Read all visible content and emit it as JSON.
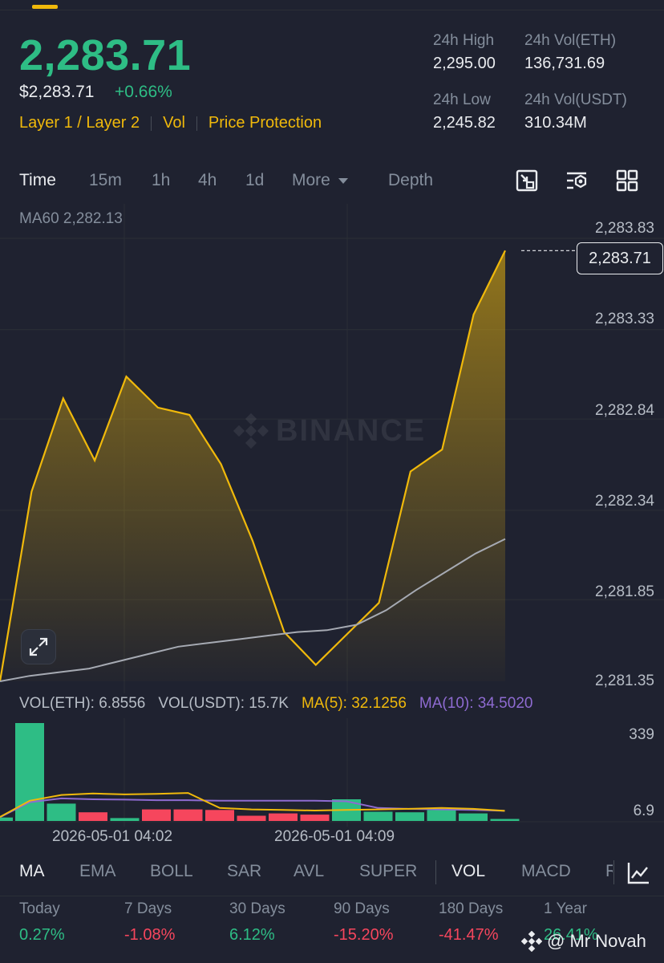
{
  "header": {
    "last_price": "2,283.71",
    "usd_price": "$2,283.71",
    "change_pct": "+0.66%",
    "tags": [
      "Layer 1 / Layer 2",
      "Vol",
      "Price Protection"
    ],
    "stats": {
      "high_label": "24h High",
      "high_value": "2,295.00",
      "vol_eth_label": "24h Vol(ETH)",
      "vol_eth_value": "136,731.69",
      "low_label": "24h Low",
      "low_value": "2,245.82",
      "vol_usdt_label": "24h Vol(USDT)",
      "vol_usdt_value": "310.34M"
    }
  },
  "tabs": {
    "time": "Time",
    "m15": "15m",
    "h1": "1h",
    "h4": "4h",
    "d1": "1d",
    "more": "More",
    "depth": "Depth"
  },
  "chart": {
    "ma60_label": "MA60 2,282.13",
    "current_price_tag": "2,283.71",
    "watermark": "BINANCE",
    "y_labels": [
      "2,283.83",
      "2,283.33",
      "2,282.84",
      "2,282.34",
      "2,281.85",
      "2,281.35"
    ]
  },
  "volume": {
    "vol_eth": "VOL(ETH): 6.8556",
    "vol_usdt": "VOL(USDT): 15.7K",
    "ma5": "MA(5): 32.1256",
    "ma10": "MA(10): 34.5020",
    "y_top": "339",
    "y_bottom": "6.9",
    "x_labels": [
      "2026-05-01 04:02",
      "2026-05-01 04:09"
    ]
  },
  "indicators": {
    "left": [
      "MA",
      "EMA",
      "BOLL",
      "SAR",
      "AVL",
      "SUPER"
    ],
    "right": [
      "VOL",
      "MACD",
      "R"
    ]
  },
  "performance": [
    {
      "label": "Today",
      "value": "0.27%"
    },
    {
      "label": "7 Days",
      "value": "-1.08%"
    },
    {
      "label": "30 Days",
      "value": "6.12%"
    },
    {
      "label": "90 Days",
      "value": "-15.20%"
    },
    {
      "label": "180 Days",
      "value": "-41.47%"
    },
    {
      "label": "1 Year",
      "value": "26.41%"
    }
  ],
  "footer_watermark": "@ Mr Novah",
  "colors": {
    "up": "#2ebd85",
    "down": "#f6465d",
    "accent": "#f0b90b",
    "ma10": "#8e6bd1",
    "bg": "#1f2230"
  },
  "chart_data": {
    "type": "area",
    "y_axis": {
      "min": 2281.35,
      "max": 2283.83
    },
    "price_series": [
      2281.35,
      2282.39,
      2282.9,
      2282.56,
      2283.02,
      2282.85,
      2282.81,
      2282.54,
      2282.12,
      2281.62,
      2281.44,
      2281.61,
      2281.78,
      2282.5,
      2282.62,
      2283.36,
      2283.71
    ],
    "ma60_series": [
      2281.35,
      2281.38,
      2281.4,
      2281.42,
      2281.46,
      2281.5,
      2281.54,
      2281.56,
      2281.58,
      2281.6,
      2281.62,
      2281.63,
      2281.66,
      2281.74,
      2281.85,
      2281.95,
      2282.05,
      2282.13
    ],
    "volume_bars": [
      {
        "dir": "up",
        "value": 339
      },
      {
        "dir": "up",
        "value": 60
      },
      {
        "dir": "down",
        "value": 30
      },
      {
        "dir": "up",
        "value": 10
      },
      {
        "dir": "down",
        "value": 40
      },
      {
        "dir": "down",
        "value": 40
      },
      {
        "dir": "down",
        "value": 38
      },
      {
        "dir": "down",
        "value": 18
      },
      {
        "dir": "down",
        "value": 26
      },
      {
        "dir": "down",
        "value": 22
      },
      {
        "dir": "up",
        "value": 75
      },
      {
        "dir": "up",
        "value": 32
      },
      {
        "dir": "up",
        "value": 30
      },
      {
        "dir": "up",
        "value": 38
      },
      {
        "dir": "up",
        "value": 26
      },
      {
        "dir": "up",
        "value": 6.9
      }
    ],
    "vol_ma5": [
      70,
      90,
      95,
      92,
      94,
      97,
      45,
      40,
      38,
      36,
      38,
      40,
      42,
      45,
      42,
      35
    ],
    "vol_ma10": [
      65,
      78,
      75,
      74,
      72,
      72,
      70,
      70,
      70,
      70,
      68,
      45,
      42,
      40,
      38,
      35
    ]
  }
}
